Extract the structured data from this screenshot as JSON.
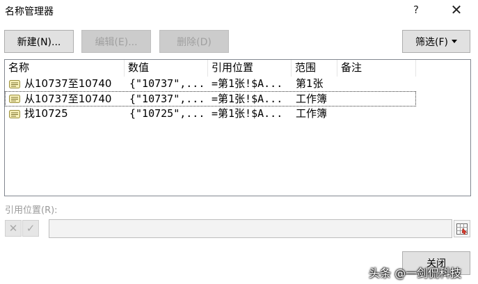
{
  "window": {
    "title": "名称管理器",
    "help": "?",
    "close": "✕"
  },
  "toolbar": {
    "new_label": "新建(N)...",
    "edit_label": "编辑(E)...",
    "delete_label": "删除(D)",
    "filter_label": "筛选(F)"
  },
  "list": {
    "headers": {
      "name": "名称",
      "value": "数值",
      "ref": "引用位置",
      "scope": "范围",
      "comment": "备注"
    },
    "rows": [
      {
        "name": "从10737至10740",
        "value": "{\"10737\",...",
        "ref": "=第1张!$A...",
        "scope": "第1张",
        "comment": ""
      },
      {
        "name": "从10737至10740",
        "value": "{\"10737\",...",
        "ref": "=第1张!$A...",
        "scope": "工作簿",
        "comment": ""
      },
      {
        "name": "找10725",
        "value": "{\"10725\",...",
        "ref": "=第1张!$A...",
        "scope": "工作簿",
        "comment": ""
      }
    ]
  },
  "refers_to": {
    "label": "引用位置(R):",
    "value": "",
    "cancel": "✕",
    "confirm": "✓"
  },
  "footer": {
    "close_label": "关闭"
  },
  "watermark": "头条 @一剑侃科技"
}
